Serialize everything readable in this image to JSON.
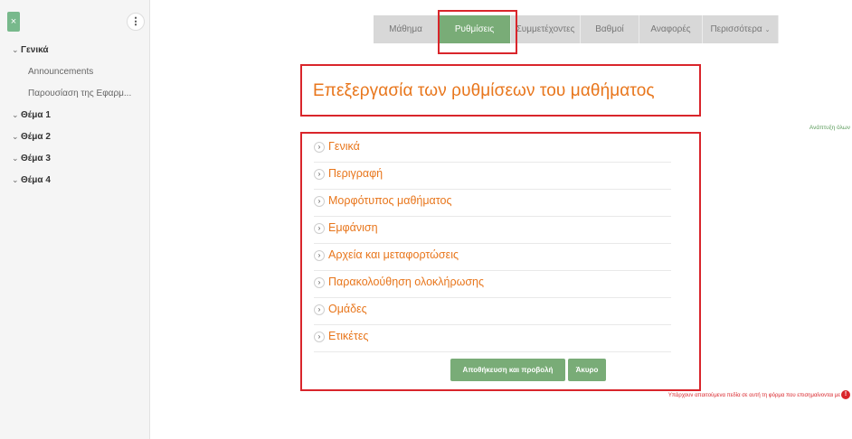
{
  "sidebar": {
    "close_label": "×",
    "menu_label": "⋮",
    "general": "Γενικά",
    "announcements": "Announcements",
    "presentation": "Παρουσίαση της Εφαρμ...",
    "topic1": "Θέμα 1",
    "topic2": "Θέμα 2",
    "topic3": "Θέμα 3",
    "topic4": "Θέμα 4",
    "chevron": "⌄"
  },
  "tabs": {
    "course": "Μάθημα",
    "settings": "Ρυθμίσεις",
    "participants": "Συμμετέχοντες",
    "grades": "Βαθμοί",
    "reports": "Αναφορές",
    "more": "Περισσότερα",
    "more_caret": "⌄"
  },
  "page": {
    "title": "Επεξεργασία των ρυθμίσεων του μαθήματος",
    "expand_all": "Ανάπτυξη όλων"
  },
  "sections": {
    "chevron": "›",
    "general": "Γενικά",
    "description": "Περιγραφή",
    "format": "Μορφότυπος μαθήματος",
    "appearance": "Εμφάνιση",
    "files": "Αρχεία και μεταφορτώσεις",
    "completion": "Παρακολούθηση ολοκλήρωσης",
    "groups": "Ομάδες",
    "tags": "Ετικέτες"
  },
  "buttons": {
    "save_display": "Αποθήκευση και προβολή",
    "cancel": "Άκυρο"
  },
  "footer": {
    "required_note": "Υπάρχουν απαιτούμενα πεδία σε αυτή τη φόρμα που επισημαίνονται με",
    "required_icon": "!"
  },
  "colors": {
    "accent_green": "#79ac77",
    "accent_orange": "#e8761c",
    "highlight_red": "#d9252b"
  }
}
